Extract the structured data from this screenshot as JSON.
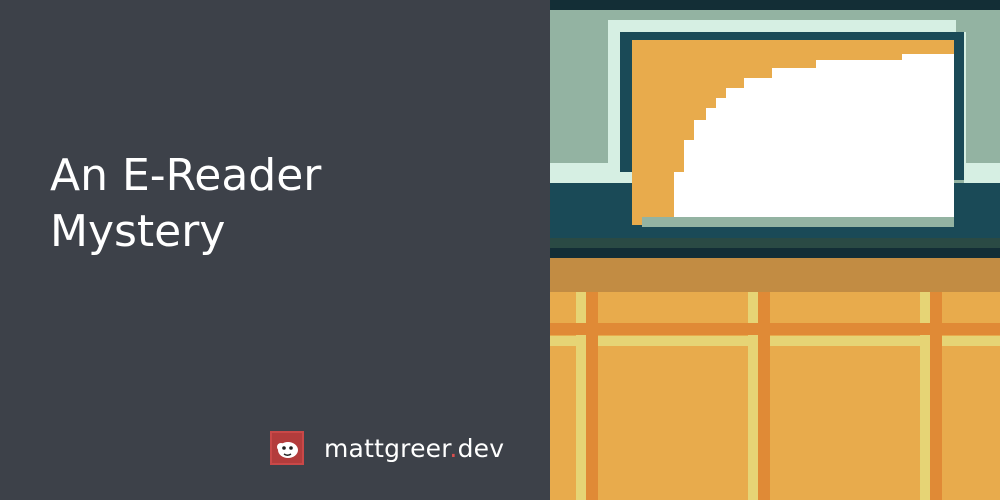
{
  "title": {
    "line1": "An E-Reader",
    "line2": "Mystery"
  },
  "brand": {
    "name": "mattgreer",
    "dot": ".",
    "tld": "dev",
    "logo_icon": "cartoon-face-icon"
  },
  "colors": {
    "background": "#3d4149",
    "title_text": "#ffffff",
    "brand_accent": "#d94f4f",
    "art_teal_dark": "#1a4a57",
    "art_sage": "#93b3a2",
    "art_mint": "#d6efe3",
    "art_orange": "#e8ab4c",
    "art_orange_dark": "#e08a36",
    "art_tan": "#c28c43",
    "art_yellow": "#e6d475"
  }
}
